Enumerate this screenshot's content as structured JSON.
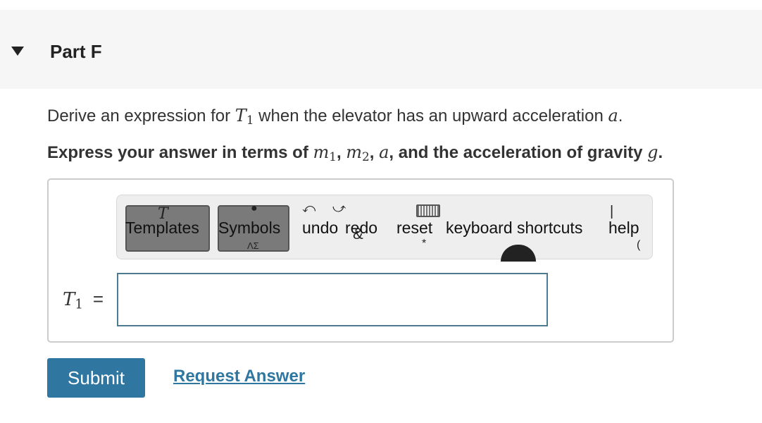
{
  "part": {
    "title": "Part F",
    "caret_icon": "caret-down-icon"
  },
  "question": {
    "prefix": "Derive an expression for ",
    "var_T": "T",
    "var_T_sub": "1",
    "middle": " when the elevator has an upward acceleration ",
    "var_a": "a",
    "suffix": "."
  },
  "instruction": {
    "prefix": "Express your answer in terms of ",
    "m1": "m",
    "m1_sub": "1",
    "sep1": ", ",
    "m2": "m",
    "m2_sub": "2",
    "sep2": ", ",
    "a": "a",
    "middle": ", and the acceleration of gravity ",
    "g": "g",
    "suffix": "."
  },
  "toolbar": {
    "templates_label": "Templates",
    "symbols_label": "Symbols",
    "undo_label": "undo",
    "redo_label": "redo",
    "reset_label": "reset",
    "keyboard_label": "keyboard shortcuts",
    "help_label": "help",
    "icons": [
      "templates-icon",
      "symbols-icon",
      "undo-icon",
      "redo-icon",
      "reset-icon",
      "keyboard-icon",
      "help-icon"
    ]
  },
  "answer": {
    "lhs_var": "T",
    "lhs_sub": "1",
    "equals": "=",
    "value": ""
  },
  "actions": {
    "submit_label": "Submit",
    "request_label": "Request Answer"
  },
  "colors": {
    "accent": "#2f77a0",
    "input_border": "#4d7b8f",
    "header_bg": "#f6f6f6"
  }
}
